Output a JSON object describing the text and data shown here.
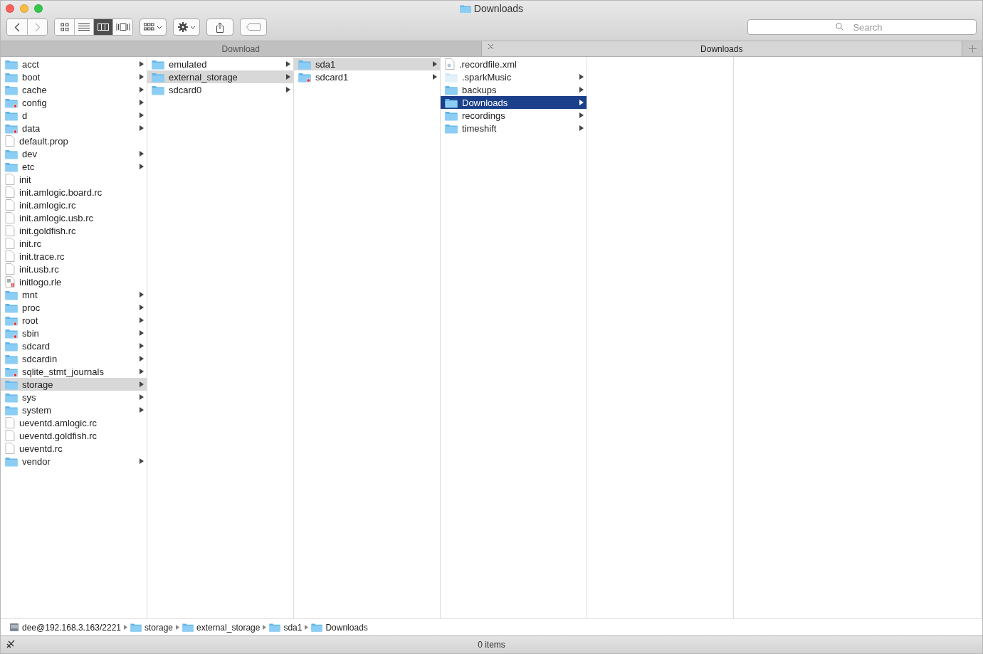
{
  "window": {
    "title": "Downloads"
  },
  "toolbar": {
    "view_modes": [
      {
        "kind": "icons",
        "selected": false
      },
      {
        "kind": "list",
        "selected": false
      },
      {
        "kind": "columns",
        "selected": true
      },
      {
        "kind": "coverflow",
        "selected": false
      }
    ]
  },
  "search": {
    "placeholder": "Search"
  },
  "tabs": [
    {
      "label": "Download",
      "selected": false,
      "closable": false
    },
    {
      "label": "Downloads",
      "selected": true,
      "closable": true
    }
  ],
  "columns": [
    {
      "items": [
        {
          "name": "acct",
          "kind": "folder",
          "locked": false,
          "arrow": true,
          "expanded": false,
          "selected": false
        },
        {
          "name": "boot",
          "kind": "folder",
          "locked": false,
          "arrow": true,
          "expanded": false,
          "selected": false
        },
        {
          "name": "cache",
          "kind": "folder",
          "locked": false,
          "arrow": true,
          "expanded": false,
          "selected": false
        },
        {
          "name": "config",
          "kind": "folder",
          "locked": true,
          "arrow": true,
          "expanded": false,
          "selected": false
        },
        {
          "name": "d",
          "kind": "folder",
          "locked": false,
          "arrow": true,
          "expanded": false,
          "selected": false
        },
        {
          "name": "data",
          "kind": "folder",
          "locked": true,
          "arrow": true,
          "expanded": false,
          "selected": false
        },
        {
          "name": "default.prop",
          "kind": "file",
          "locked": false,
          "arrow": false,
          "expanded": false,
          "selected": false
        },
        {
          "name": "dev",
          "kind": "folder",
          "locked": false,
          "arrow": true,
          "expanded": false,
          "selected": false
        },
        {
          "name": "etc",
          "kind": "folder",
          "locked": false,
          "arrow": true,
          "expanded": false,
          "selected": false
        },
        {
          "name": "init",
          "kind": "file",
          "locked": false,
          "arrow": false,
          "expanded": false,
          "selected": false
        },
        {
          "name": "init.amlogic.board.rc",
          "kind": "file",
          "locked": false,
          "arrow": false,
          "expanded": false,
          "selected": false
        },
        {
          "name": "init.amlogic.rc",
          "kind": "file",
          "locked": false,
          "arrow": false,
          "expanded": false,
          "selected": false
        },
        {
          "name": "init.amlogic.usb.rc",
          "kind": "file",
          "locked": false,
          "arrow": false,
          "expanded": false,
          "selected": false
        },
        {
          "name": "init.goldfish.rc",
          "kind": "file",
          "locked": false,
          "arrow": false,
          "expanded": false,
          "selected": false
        },
        {
          "name": "init.rc",
          "kind": "file",
          "locked": false,
          "arrow": false,
          "expanded": false,
          "selected": false
        },
        {
          "name": "init.trace.rc",
          "kind": "file",
          "locked": false,
          "arrow": false,
          "expanded": false,
          "selected": false
        },
        {
          "name": "init.usb.rc",
          "kind": "file",
          "locked": false,
          "arrow": false,
          "expanded": false,
          "selected": false
        },
        {
          "name": "initlogo.rle",
          "kind": "image",
          "locked": false,
          "arrow": false,
          "expanded": false,
          "selected": false
        },
        {
          "name": "mnt",
          "kind": "folder",
          "locked": false,
          "arrow": true,
          "expanded": false,
          "selected": false
        },
        {
          "name": "proc",
          "kind": "folder",
          "locked": false,
          "arrow": true,
          "expanded": false,
          "selected": false
        },
        {
          "name": "root",
          "kind": "folder",
          "locked": true,
          "arrow": true,
          "expanded": false,
          "selected": false
        },
        {
          "name": "sbin",
          "kind": "folder",
          "locked": true,
          "arrow": true,
          "expanded": false,
          "selected": false
        },
        {
          "name": "sdcard",
          "kind": "folder",
          "locked": false,
          "arrow": true,
          "expanded": false,
          "selected": false
        },
        {
          "name": "sdcardin",
          "kind": "folder",
          "locked": false,
          "arrow": true,
          "expanded": false,
          "selected": false
        },
        {
          "name": "sqlite_stmt_journals",
          "kind": "folder",
          "locked": true,
          "arrow": true,
          "expanded": false,
          "selected": false
        },
        {
          "name": "storage",
          "kind": "folder",
          "locked": false,
          "arrow": true,
          "expanded": true,
          "selected": false
        },
        {
          "name": "sys",
          "kind": "folder",
          "locked": false,
          "arrow": true,
          "expanded": false,
          "selected": false
        },
        {
          "name": "system",
          "kind": "folder",
          "locked": false,
          "arrow": true,
          "expanded": false,
          "selected": false
        },
        {
          "name": "ueventd.amlogic.rc",
          "kind": "file",
          "locked": false,
          "arrow": false,
          "expanded": false,
          "selected": false
        },
        {
          "name": "ueventd.goldfish.rc",
          "kind": "file",
          "locked": false,
          "arrow": false,
          "expanded": false,
          "selected": false
        },
        {
          "name": "ueventd.rc",
          "kind": "file",
          "locked": false,
          "arrow": false,
          "expanded": false,
          "selected": false
        },
        {
          "name": "vendor",
          "kind": "folder",
          "locked": false,
          "arrow": true,
          "expanded": false,
          "selected": false
        }
      ]
    },
    {
      "items": [
        {
          "name": "emulated",
          "kind": "folder",
          "locked": false,
          "arrow": true,
          "expanded": false,
          "selected": false
        },
        {
          "name": "external_storage",
          "kind": "folder",
          "locked": false,
          "arrow": true,
          "expanded": true,
          "selected": false
        },
        {
          "name": "sdcard0",
          "kind": "folder",
          "locked": false,
          "arrow": true,
          "expanded": false,
          "selected": false
        }
      ]
    },
    {
      "items": [
        {
          "name": "sda1",
          "kind": "folder",
          "locked": false,
          "arrow": true,
          "expanded": true,
          "selected": false
        },
        {
          "name": "sdcard1",
          "kind": "folder",
          "locked": true,
          "arrow": true,
          "expanded": false,
          "selected": false
        }
      ]
    },
    {
      "items": [
        {
          "name": ".recordfile.xml",
          "kind": "xml",
          "locked": false,
          "arrow": false,
          "expanded": false,
          "selected": false
        },
        {
          "name": ".sparkMusic",
          "kind": "hidden-folder",
          "locked": false,
          "arrow": true,
          "expanded": false,
          "selected": false
        },
        {
          "name": "backups",
          "kind": "folder",
          "locked": false,
          "arrow": true,
          "expanded": false,
          "selected": false
        },
        {
          "name": "Downloads",
          "kind": "folder",
          "locked": false,
          "arrow": true,
          "expanded": false,
          "selected": true
        },
        {
          "name": "recordings",
          "kind": "folder",
          "locked": false,
          "arrow": true,
          "expanded": false,
          "selected": false
        },
        {
          "name": "timeshift",
          "kind": "folder",
          "locked": false,
          "arrow": true,
          "expanded": false,
          "selected": false
        }
      ]
    }
  ],
  "path_bar": [
    {
      "label": "dee@192.168.3.163/2221",
      "kind": "server"
    },
    {
      "label": "storage",
      "kind": "folder"
    },
    {
      "label": "external_storage",
      "kind": "folder"
    },
    {
      "label": "sda1",
      "kind": "folder"
    },
    {
      "label": "Downloads",
      "kind": "folder"
    }
  ],
  "status_bar": {
    "text": "0 items"
  }
}
